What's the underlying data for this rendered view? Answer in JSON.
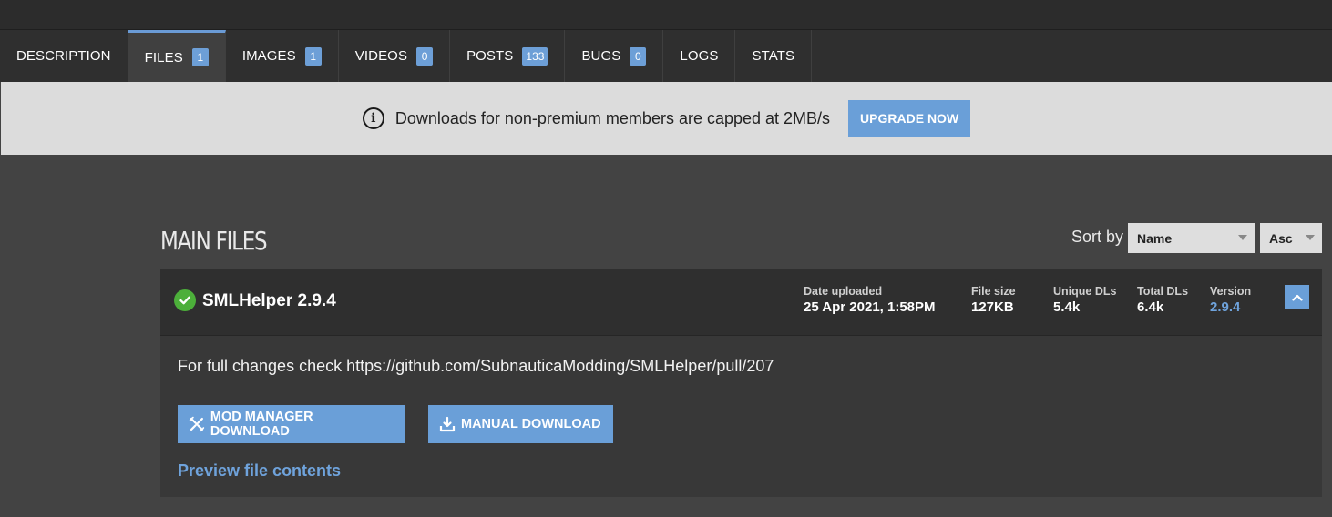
{
  "tabs": [
    {
      "label": "DESCRIPTION",
      "count": null,
      "active": false
    },
    {
      "label": "FILES",
      "count": "1",
      "active": true
    },
    {
      "label": "IMAGES",
      "count": "1",
      "active": false
    },
    {
      "label": "VIDEOS",
      "count": "0",
      "active": false
    },
    {
      "label": "POSTS",
      "count": "133",
      "active": false
    },
    {
      "label": "BUGS",
      "count": "0",
      "active": false
    },
    {
      "label": "LOGS",
      "count": null,
      "active": false
    },
    {
      "label": "STATS",
      "count": null,
      "active": false
    }
  ],
  "notice": {
    "message": "Downloads for non-premium members are capped at 2MB/s",
    "upgrade_label": "UPGRADE NOW",
    "icon": "info-icon"
  },
  "section": {
    "title": "MAIN FILES",
    "sort_label": "Sort by",
    "sort_field": "Name",
    "sort_order": "Asc"
  },
  "file": {
    "name": "SMLHelper 2.9.4",
    "status_icon": "check-circle-icon",
    "meta": {
      "date_label": "Date uploaded",
      "date_value": "25 Apr 2021, 1:58PM",
      "size_label": "File size",
      "size_value": "127KB",
      "unique_label": "Unique DLs",
      "unique_value": "5.4k",
      "total_label": "Total DLs",
      "total_value": "6.4k",
      "version_label": "Version",
      "version_value": "2.9.4"
    },
    "description": "For full changes check https://github.com/SubnauticaModding/SMLHelper/pull/207",
    "mod_manager_label": "MOD MANAGER DOWNLOAD",
    "manual_label": "MANUAL DOWNLOAD",
    "preview_label": "Preview file contents"
  },
  "colors": {
    "accent": "#6a9fd8",
    "success": "#4caf3a",
    "background": "#434343"
  }
}
